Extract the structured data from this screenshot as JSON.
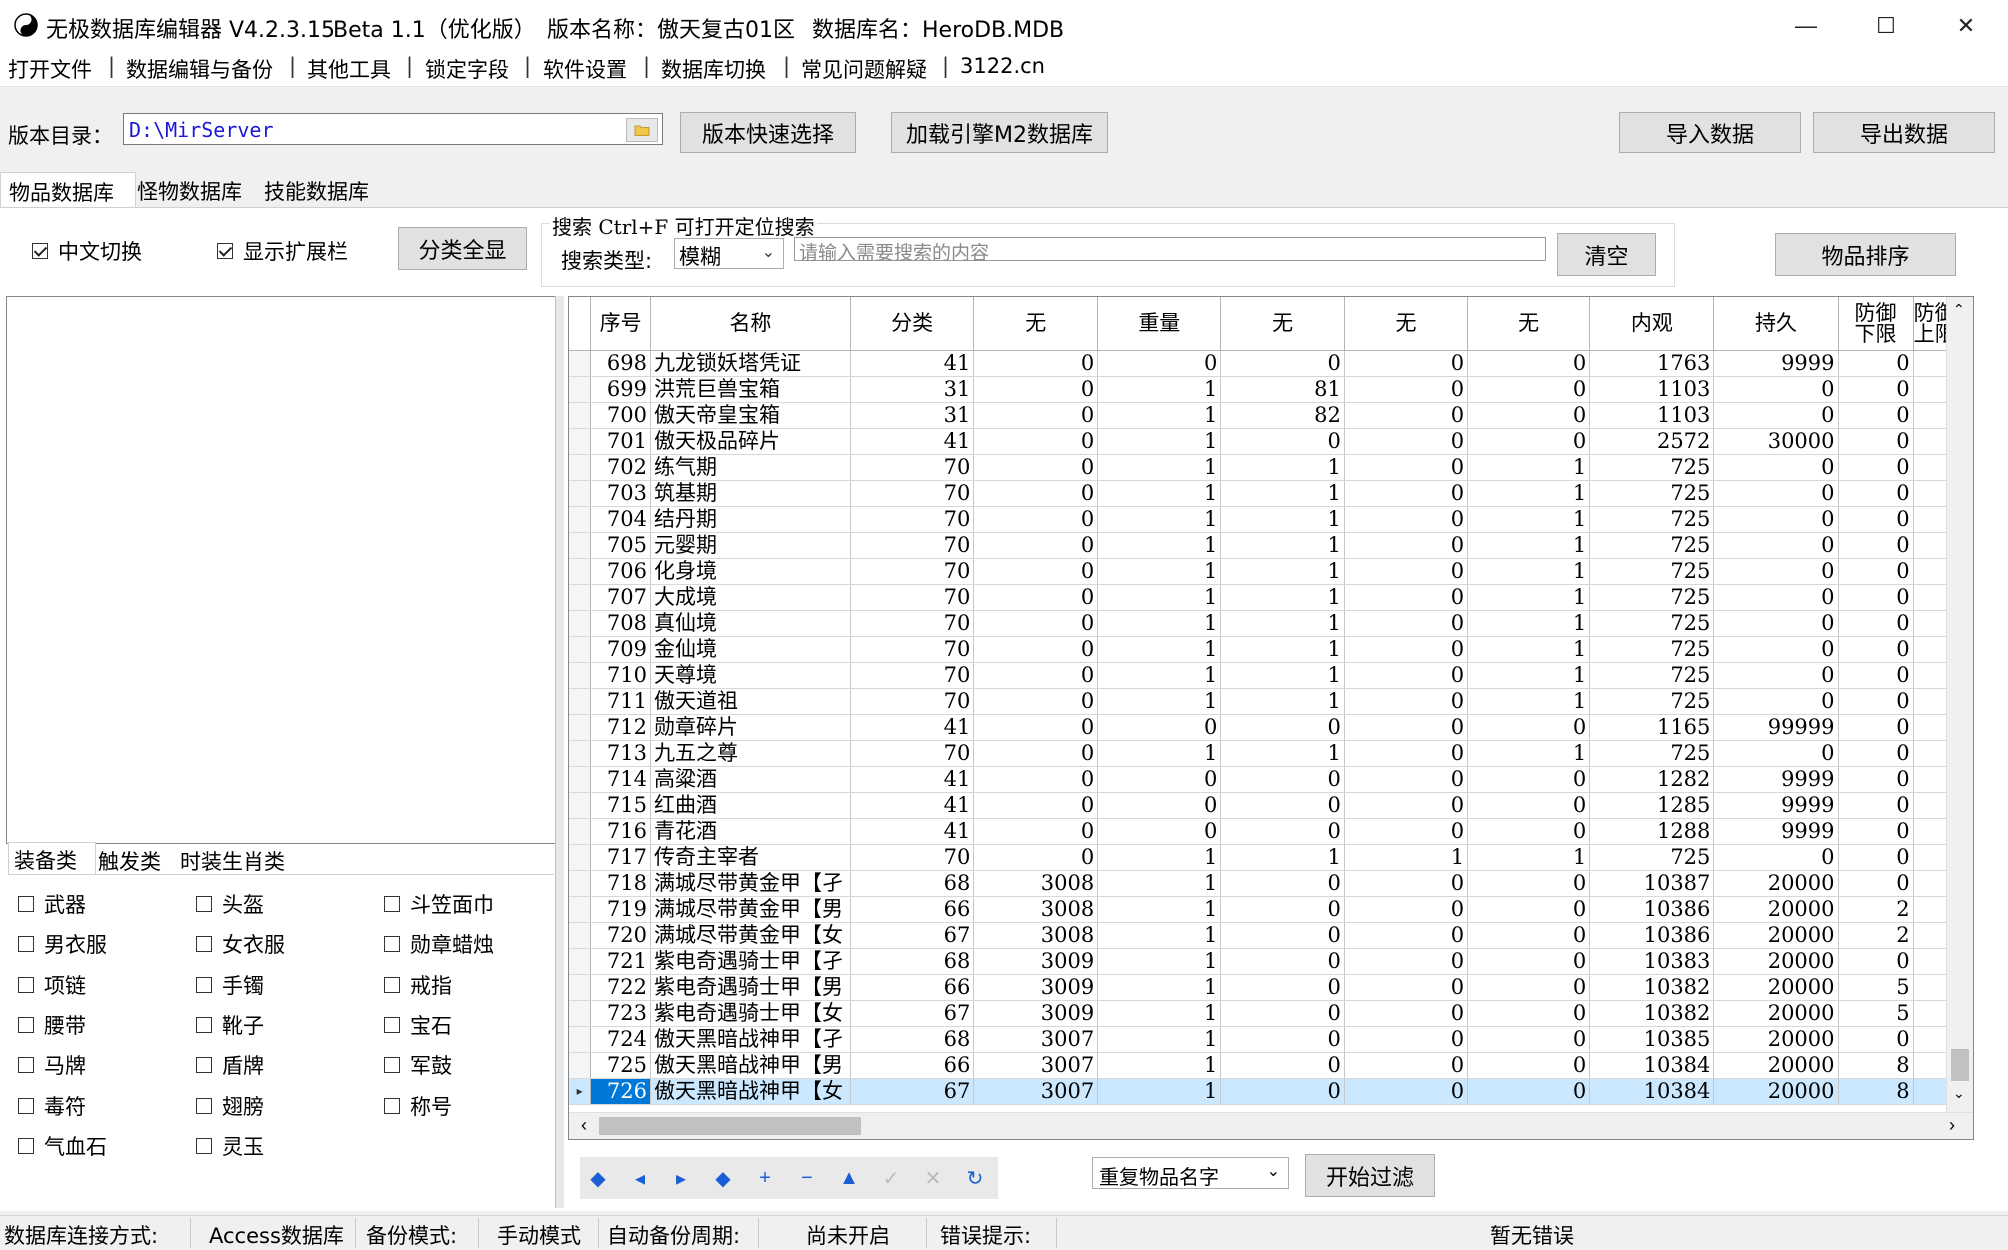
{
  "window": {
    "title": "无极数据库编辑器 V4.2.3.15",
    "beta": "Beta 1.1（优化版）",
    "version_name": "版本名称：傲天复古01区",
    "db_name": "数据库名：HeroDB.MDB",
    "icon": "yin-yang-icon",
    "minimize": "—",
    "maximize": "☐",
    "close": "✕"
  },
  "menu": [
    "打开文件",
    "数据编辑与备份",
    "其他工具",
    "锁定字段",
    "软件设置",
    "数据库切换",
    "常见问题解疑",
    "3122.cn"
  ],
  "menu_sep": "|",
  "toolbar": {
    "dir_label": "版本目录：",
    "dir_value": "D:\\MirServer",
    "folder_icon": "folder-icon",
    "quick_select": "版本快速选择",
    "load_m2": "加载引擎M2数据库",
    "import": "导入数据",
    "export": "导出数据"
  },
  "tabs": [
    "物品数据库",
    "怪物数据库",
    "技能数据库"
  ],
  "options": {
    "cn_switch": "中文切换",
    "show_ext": "显示扩展栏",
    "category_all": "分类全显",
    "search_title": "搜索  Ctrl+F 可打开定位搜索",
    "search_type_label": "搜索类型:",
    "search_type_value": "模糊",
    "search_placeholder": "请输入需要搜索的内容",
    "clear": "清空",
    "sort": "物品排序"
  },
  "category_tabs": [
    "装备类",
    "触发类",
    "时装生肖类"
  ],
  "categories": [
    [
      "武器",
      "头盔",
      "斗笠面巾"
    ],
    [
      "男衣服",
      "女衣服",
      "勋章蜡烛"
    ],
    [
      "项链",
      "手镯",
      "戒指"
    ],
    [
      "腰带",
      "靴子",
      "宝石"
    ],
    [
      "马牌",
      "盾牌",
      "军鼓"
    ],
    [
      "毒符",
      "翅膀",
      "称号"
    ],
    [
      "气血石",
      "灵玉",
      ""
    ]
  ],
  "table": {
    "columns": [
      "序号",
      "名称",
      "分类",
      "无",
      "重量",
      "无",
      "无",
      "无",
      "内观",
      "持久",
      "防御\n下限",
      "防御\n上限"
    ],
    "rows": [
      [
        "698",
        "九龙锁妖塔凭证",
        "41",
        "0",
        "0",
        "0",
        "0",
        "0",
        "1763",
        "9999",
        "0"
      ],
      [
        "699",
        "洪荒巨兽宝箱",
        "31",
        "0",
        "1",
        "81",
        "0",
        "0",
        "1103",
        "0",
        "0"
      ],
      [
        "700",
        "傲天帝皇宝箱",
        "31",
        "0",
        "1",
        "82",
        "0",
        "0",
        "1103",
        "0",
        "0"
      ],
      [
        "701",
        "傲天极品碎片",
        "41",
        "0",
        "1",
        "0",
        "0",
        "0",
        "2572",
        "30000",
        "0"
      ],
      [
        "702",
        "练气期",
        "70",
        "0",
        "1",
        "1",
        "0",
        "1",
        "725",
        "0",
        "0"
      ],
      [
        "703",
        "筑基期",
        "70",
        "0",
        "1",
        "1",
        "0",
        "1",
        "725",
        "0",
        "0"
      ],
      [
        "704",
        "结丹期",
        "70",
        "0",
        "1",
        "1",
        "0",
        "1",
        "725",
        "0",
        "0"
      ],
      [
        "705",
        "元婴期",
        "70",
        "0",
        "1",
        "1",
        "0",
        "1",
        "725",
        "0",
        "0"
      ],
      [
        "706",
        "化身境",
        "70",
        "0",
        "1",
        "1",
        "0",
        "1",
        "725",
        "0",
        "0"
      ],
      [
        "707",
        "大成境",
        "70",
        "0",
        "1",
        "1",
        "0",
        "1",
        "725",
        "0",
        "0"
      ],
      [
        "708",
        "真仙境",
        "70",
        "0",
        "1",
        "1",
        "0",
        "1",
        "725",
        "0",
        "0"
      ],
      [
        "709",
        "金仙境",
        "70",
        "0",
        "1",
        "1",
        "0",
        "1",
        "725",
        "0",
        "0"
      ],
      [
        "710",
        "天尊境",
        "70",
        "0",
        "1",
        "1",
        "0",
        "1",
        "725",
        "0",
        "0"
      ],
      [
        "711",
        "傲天道祖",
        "70",
        "0",
        "1",
        "1",
        "0",
        "1",
        "725",
        "0",
        "0"
      ],
      [
        "712",
        "勋章碎片",
        "41",
        "0",
        "0",
        "0",
        "0",
        "0",
        "1165",
        "99999",
        "0"
      ],
      [
        "713",
        "九五之尊",
        "70",
        "0",
        "1",
        "1",
        "0",
        "1",
        "725",
        "0",
        "0"
      ],
      [
        "714",
        "高粱酒",
        "41",
        "0",
        "0",
        "0",
        "0",
        "0",
        "1282",
        "9999",
        "0"
      ],
      [
        "715",
        "红曲酒",
        "41",
        "0",
        "0",
        "0",
        "0",
        "0",
        "1285",
        "9999",
        "0"
      ],
      [
        "716",
        "青花酒",
        "41",
        "0",
        "0",
        "0",
        "0",
        "0",
        "1288",
        "9999",
        "0"
      ],
      [
        "717",
        "传奇主宰者",
        "70",
        "0",
        "1",
        "1",
        "1",
        "1",
        "725",
        "0",
        "0"
      ],
      [
        "718",
        "满城尽带黄金甲【孑",
        "68",
        "3008",
        "1",
        "0",
        "0",
        "0",
        "10387",
        "20000",
        "0"
      ],
      [
        "719",
        "满城尽带黄金甲【男",
        "66",
        "3008",
        "1",
        "0",
        "0",
        "0",
        "10386",
        "20000",
        "2"
      ],
      [
        "720",
        "满城尽带黄金甲【女",
        "67",
        "3008",
        "1",
        "0",
        "0",
        "0",
        "10386",
        "20000",
        "2"
      ],
      [
        "721",
        "紫电奇遇骑士甲【孑",
        "68",
        "3009",
        "1",
        "0",
        "0",
        "0",
        "10383",
        "20000",
        "0"
      ],
      [
        "722",
        "紫电奇遇骑士甲【男",
        "66",
        "3009",
        "1",
        "0",
        "0",
        "0",
        "10382",
        "20000",
        "5"
      ],
      [
        "723",
        "紫电奇遇骑士甲【女",
        "67",
        "3009",
        "1",
        "0",
        "0",
        "0",
        "10382",
        "20000",
        "5"
      ],
      [
        "724",
        "傲天黑暗战神甲【孑",
        "68",
        "3007",
        "1",
        "0",
        "0",
        "0",
        "10385",
        "20000",
        "0"
      ],
      [
        "725",
        "傲天黑暗战神甲【男",
        "66",
        "3007",
        "1",
        "0",
        "0",
        "0",
        "10384",
        "20000",
        "8"
      ],
      [
        "726",
        "傲天黑暗战神甲【女",
        "67",
        "3007",
        "1",
        "0",
        "0",
        "0",
        "10384",
        "20000",
        "8"
      ]
    ],
    "selected_index": 28,
    "row_pointer": "▸"
  },
  "nav": [
    "◆",
    "◂",
    "▸",
    "◆",
    "+",
    "−",
    "▲",
    "✓",
    "✕",
    "↻"
  ],
  "filter": {
    "select_value": "重复物品名字",
    "start": "开始过滤"
  },
  "status": {
    "conn_label": "数据库连接方式:",
    "conn_value": "Access数据库",
    "backup_label": "备份模式:",
    "backup_value": "手动模式",
    "auto_label": "自动备份周期:",
    "auto_value": "尚未开启",
    "err_label": "错误提示:",
    "err_value": "暂无错误"
  }
}
